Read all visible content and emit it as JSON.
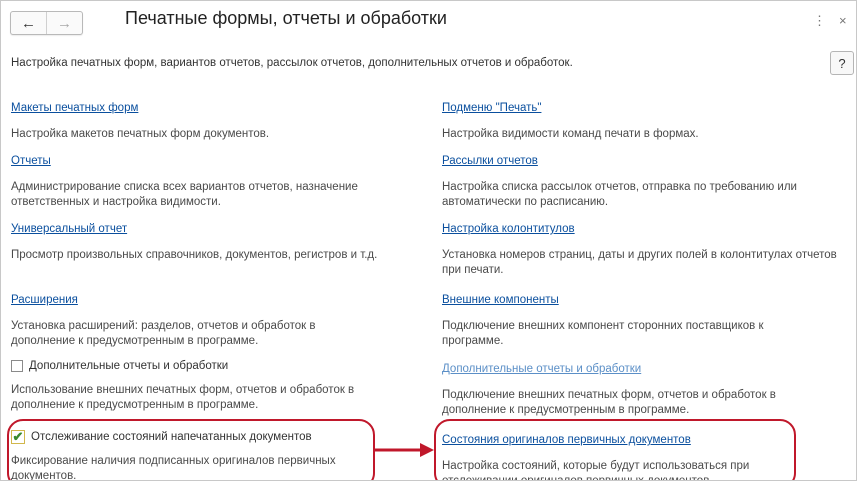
{
  "window": {
    "title": "Печатные формы, отчеты и обработки",
    "back_glyph": "←",
    "forward_glyph": "→",
    "more_glyph": "⋮",
    "close_glyph": "×",
    "help_glyph": "?"
  },
  "description": "Настройка печатных форм, вариантов отчетов, рассылок отчетов, дополнительных отчетов и обработок.",
  "left": {
    "item1": {
      "link": "Макеты печатных форм",
      "desc": "Настройка макетов печатных форм документов."
    },
    "item2": {
      "link": "Отчеты",
      "desc": "Администрирование списка всех вариантов отчетов, назначение ответственных и настройка видимости."
    },
    "item3": {
      "link": "Универсальный отчет",
      "desc": "Просмотр произвольных справочников, документов, регистров и т.д."
    },
    "item4": {
      "link": "Расширения",
      "desc": "Установка расширений: разделов, отчетов и обработок в дополнение к предусмотренным в программе."
    },
    "item5": {
      "label": "Дополнительные отчеты и обработки",
      "checked": false,
      "desc": "Использование внешних печатных форм, отчетов и обработок в дополнение к предусмотренным в программе."
    },
    "item6": {
      "label": "Отслеживание состояний напечатанных документов",
      "checked": true,
      "checkmark": "✔",
      "desc": "Фиксирование наличия подписанных оригиналов первичных документов."
    }
  },
  "right": {
    "item1": {
      "link": "Подменю \"Печать\"",
      "desc": "Настройка видимости команд печати в формах."
    },
    "item2": {
      "link": "Рассылки отчетов",
      "desc": "Настройка списка рассылок отчетов, отправка по требованию или автоматически по расписанию."
    },
    "item3": {
      "link": "Настройка колонтитулов",
      "desc": "Установка номеров страниц, даты и других полей в колонтитулах отчетов при печати."
    },
    "item4": {
      "link": "Внешние компоненты",
      "desc": "Подключение внешних компонент сторонних поставщиков к программе."
    },
    "item5": {
      "link": "Дополнительные отчеты и обработки",
      "desc": "Подключение внешних печатных форм, отчетов и обработок в дополнение к предусмотренным в программе."
    },
    "item6": {
      "link": "Состояния оригиналов первичных документов",
      "desc": "Настройка состояний, которые будут использоваться при отслеживании оригиналов первичных документов."
    }
  },
  "colors": {
    "link": "#0a4f9e",
    "link_disabled": "#5b8fc7",
    "highlight": "#c0182b",
    "checkmark": "#3a8a2e"
  }
}
